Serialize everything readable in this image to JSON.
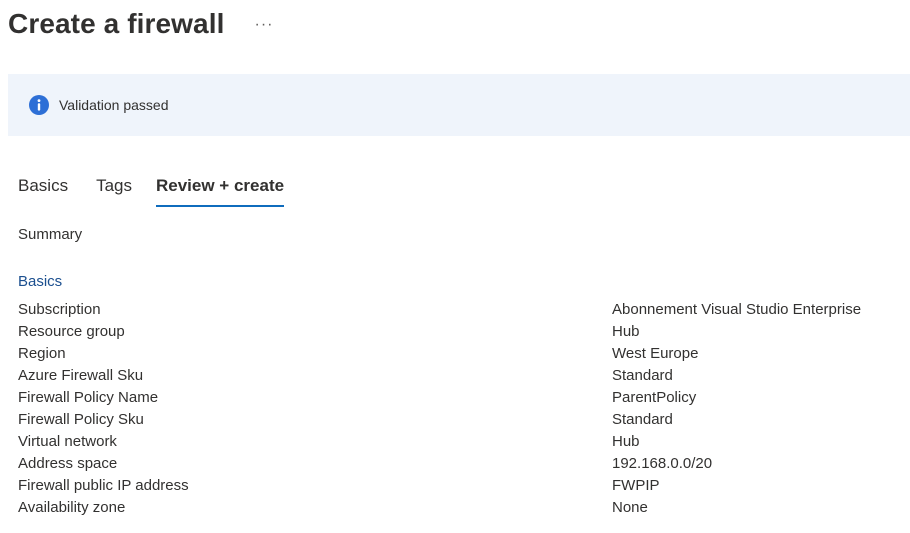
{
  "header": {
    "title": "Create a firewall",
    "more_label": "···"
  },
  "banner": {
    "icon": "info-icon",
    "text": "Validation passed",
    "icon_color": "#2d6fd6",
    "background": "#eff4fb"
  },
  "tabs": [
    {
      "label": "Basics",
      "active": false
    },
    {
      "label": "Tags",
      "active": false
    },
    {
      "label": "Review + create",
      "active": true
    }
  ],
  "summary_label": "Summary",
  "sections": {
    "basics": {
      "heading": "Basics",
      "rows": [
        {
          "label": "Subscription",
          "value": "Abonnement Visual Studio Enterprise"
        },
        {
          "label": "Resource group",
          "value": "Hub"
        },
        {
          "label": "Region",
          "value": "West Europe"
        },
        {
          "label": "Azure Firewall Sku",
          "value": "Standard"
        },
        {
          "label": "Firewall Policy Name",
          "value": "ParentPolicy"
        },
        {
          "label": "Firewall Policy Sku",
          "value": "Standard"
        },
        {
          "label": "Virtual network",
          "value": "Hub"
        },
        {
          "label": "Address space",
          "value": "192.168.0.0/20"
        },
        {
          "label": "Firewall public IP address",
          "value": "FWPIP"
        },
        {
          "label": "Availability zone",
          "value": "None"
        }
      ]
    }
  },
  "colors": {
    "accent": "#0f6cbd",
    "section_heading": "#1b4f8f",
    "text": "#323130"
  }
}
